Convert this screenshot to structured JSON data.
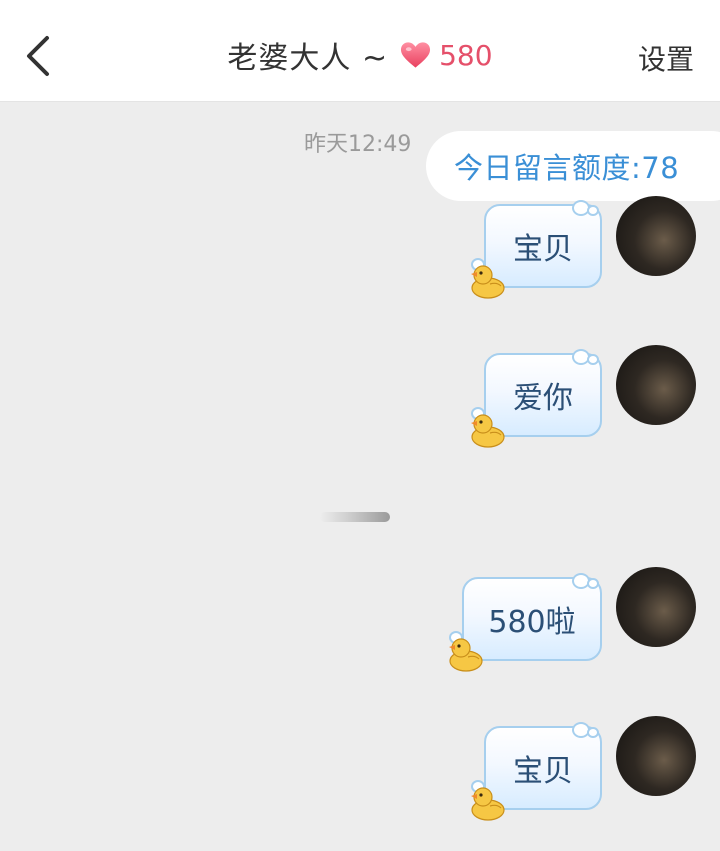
{
  "header": {
    "title": "老婆大人 ~",
    "intimacy_score": "580",
    "settings_label": "设置",
    "heart_color": "#f0607a"
  },
  "chat": {
    "timestamp": "昨天12:49",
    "quota_text": "今日留言额度:78",
    "messages": [
      {
        "text": "宝贝"
      },
      {
        "text": "爱你"
      },
      {
        "text": "580啦"
      },
      {
        "text": "宝贝"
      }
    ]
  },
  "icons": {
    "back": "chevron-left-icon",
    "heart": "heart-icon",
    "duck": "duck-icon"
  },
  "colors": {
    "background": "#ededed",
    "bubble_border": "#a6cfee",
    "quota_text": "#3a8fd6",
    "score_text": "#e5506a"
  }
}
